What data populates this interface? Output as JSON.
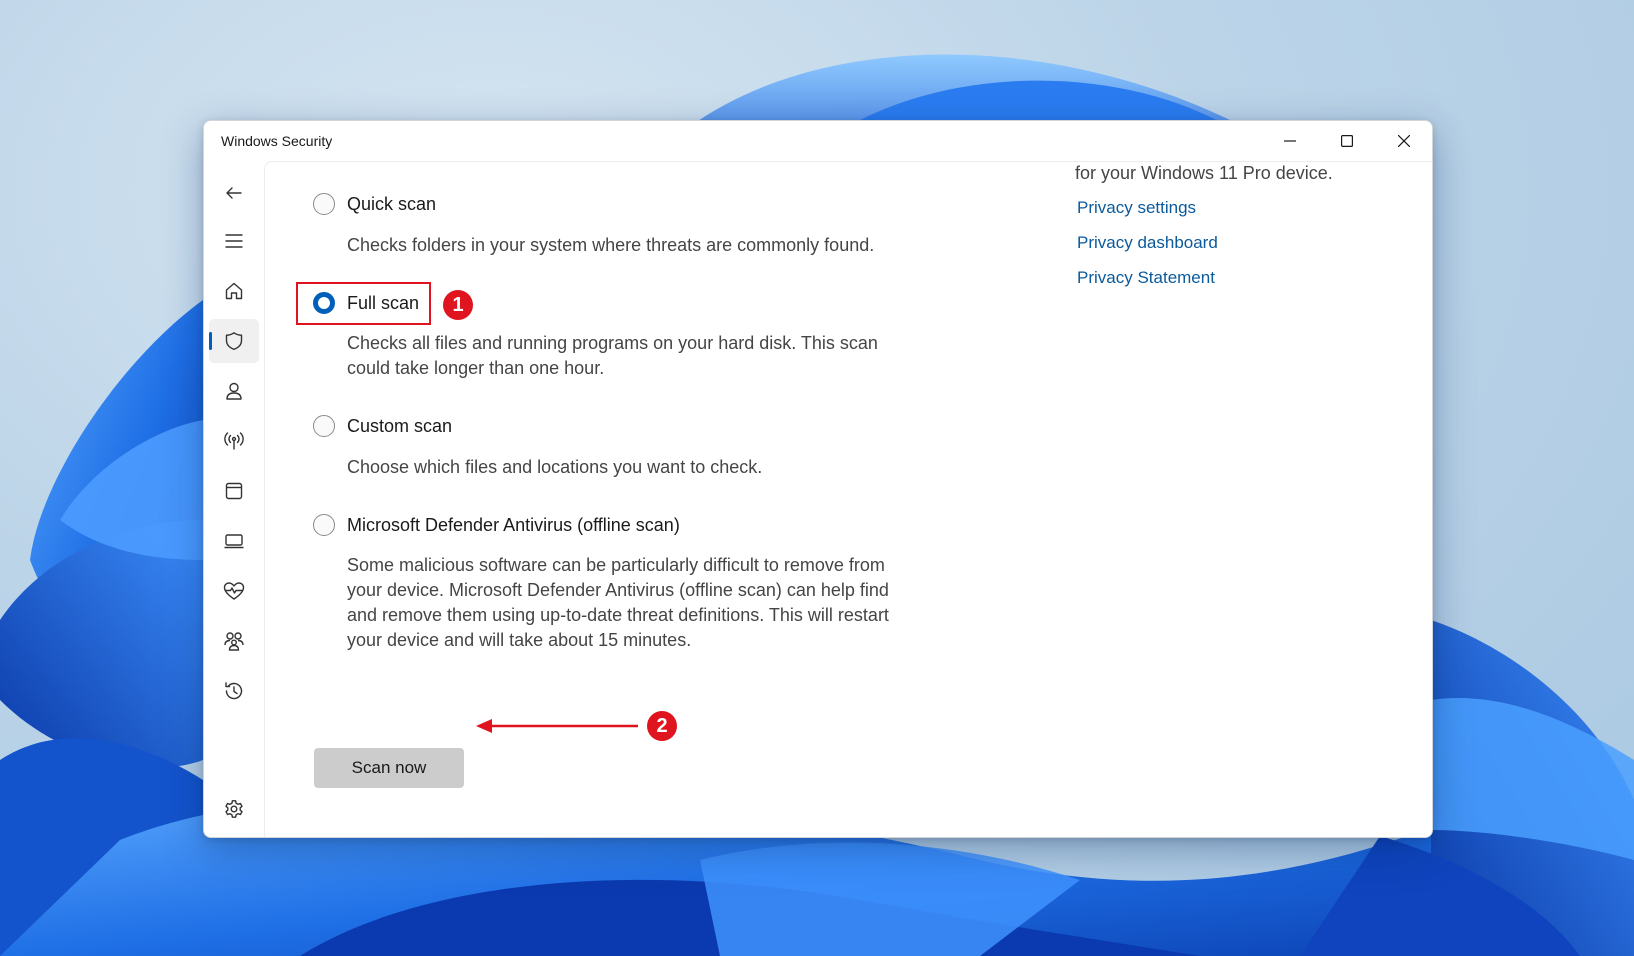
{
  "window": {
    "title": "Windows Security",
    "controls": {
      "minimize_icon": "minimize-icon",
      "maximize_icon": "maximize-icon",
      "close_icon": "close-icon"
    }
  },
  "sidebar": {
    "items": [
      {
        "name": "back",
        "icon": "back-arrow-icon"
      },
      {
        "name": "menu",
        "icon": "hamburger-menu-icon"
      },
      {
        "name": "home",
        "icon": "home-icon"
      },
      {
        "name": "virus-threat-protection",
        "icon": "shield-icon",
        "active": true
      },
      {
        "name": "account-protection",
        "icon": "person-icon"
      },
      {
        "name": "firewall-network",
        "icon": "antenna-icon"
      },
      {
        "name": "app-browser-control",
        "icon": "app-window-icon"
      },
      {
        "name": "device-security",
        "icon": "laptop-icon"
      },
      {
        "name": "device-performance-health",
        "icon": "heart-pulse-icon"
      },
      {
        "name": "family-options",
        "icon": "family-icon"
      },
      {
        "name": "protection-history",
        "icon": "history-icon"
      },
      {
        "name": "settings",
        "icon": "gear-icon"
      }
    ]
  },
  "scan_options": {
    "selected": "Full scan",
    "quick": {
      "label": "Quick scan",
      "description": "Checks folders in your system where threats are commonly found."
    },
    "full": {
      "label": "Full scan",
      "description_line1": "Checks all files and running programs on your hard disk. This scan",
      "description_line2": "could take longer than one hour."
    },
    "custom": {
      "label": "Custom scan",
      "description": "Choose which files and locations you want to check."
    },
    "offline": {
      "label": "Microsoft Defender Antivirus (offline scan)",
      "description_line1": "Some malicious software can be particularly difficult to remove from",
      "description_line2": "your device. Microsoft Defender Antivirus (offline scan) can help find",
      "description_line3": "and remove them using up-to-date threat definitions. This will restart",
      "description_line4": "your device and will take about 15 minutes."
    }
  },
  "scan_button_label": "Scan now",
  "privacy": {
    "cut_text": "for your Windows 11 Pro device.",
    "links": [
      "Privacy settings",
      "Privacy dashboard",
      "Privacy Statement"
    ]
  },
  "annotations": {
    "step1": "1",
    "step2": "2"
  },
  "colors": {
    "accent": "#005fb8",
    "link": "#0b5a9c",
    "annotation_red": "#e0141e",
    "button_bg": "#cccccc"
  }
}
